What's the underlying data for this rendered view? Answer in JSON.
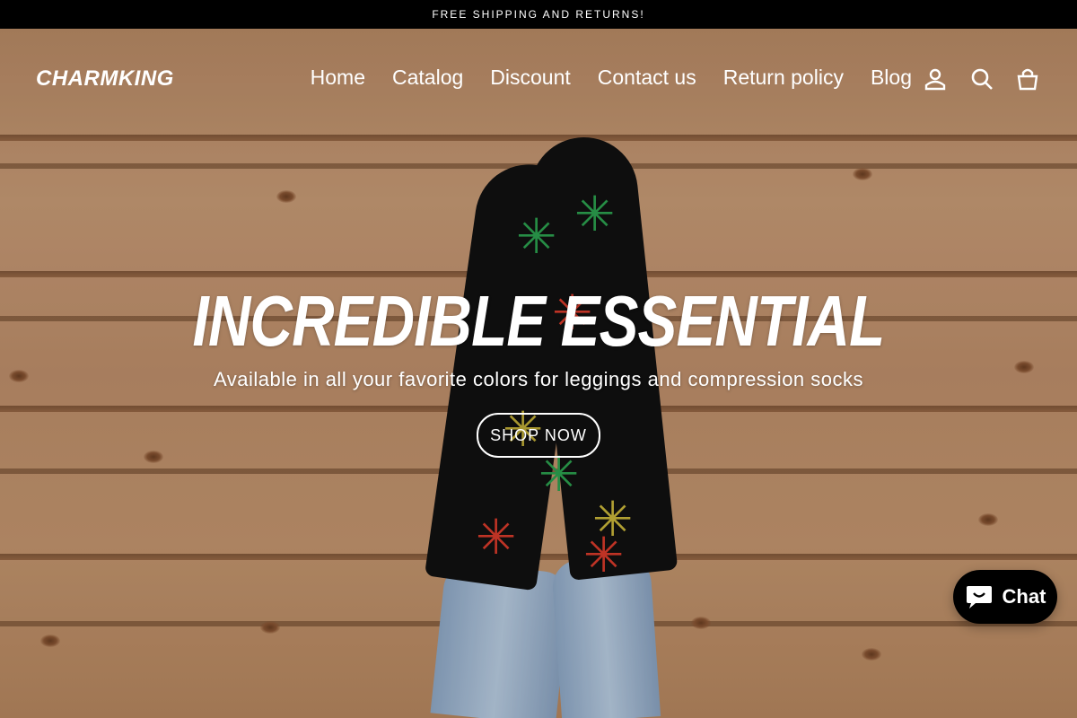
{
  "announcement": {
    "text": "FREE SHIPPING AND RETURNS!"
  },
  "header": {
    "logo": "CHARMKING",
    "nav": [
      {
        "label": "Home"
      },
      {
        "label": "Catalog"
      },
      {
        "label": "Discount"
      },
      {
        "label": "Contact us"
      },
      {
        "label": "Return policy"
      },
      {
        "label": "Blog"
      }
    ],
    "icons": [
      "account-icon",
      "search-icon",
      "cart-icon"
    ]
  },
  "hero": {
    "headline": "INCREDIBLE ESSENTIAL",
    "subhead": "Available in all your favorite colors for leggings and compression socks",
    "cta_label": "SHOP NOW"
  },
  "chat": {
    "label": "Chat"
  },
  "colors": {
    "announcement_bg": "#000000",
    "text_on_hero": "#ffffff",
    "chat_bg": "#000000"
  }
}
